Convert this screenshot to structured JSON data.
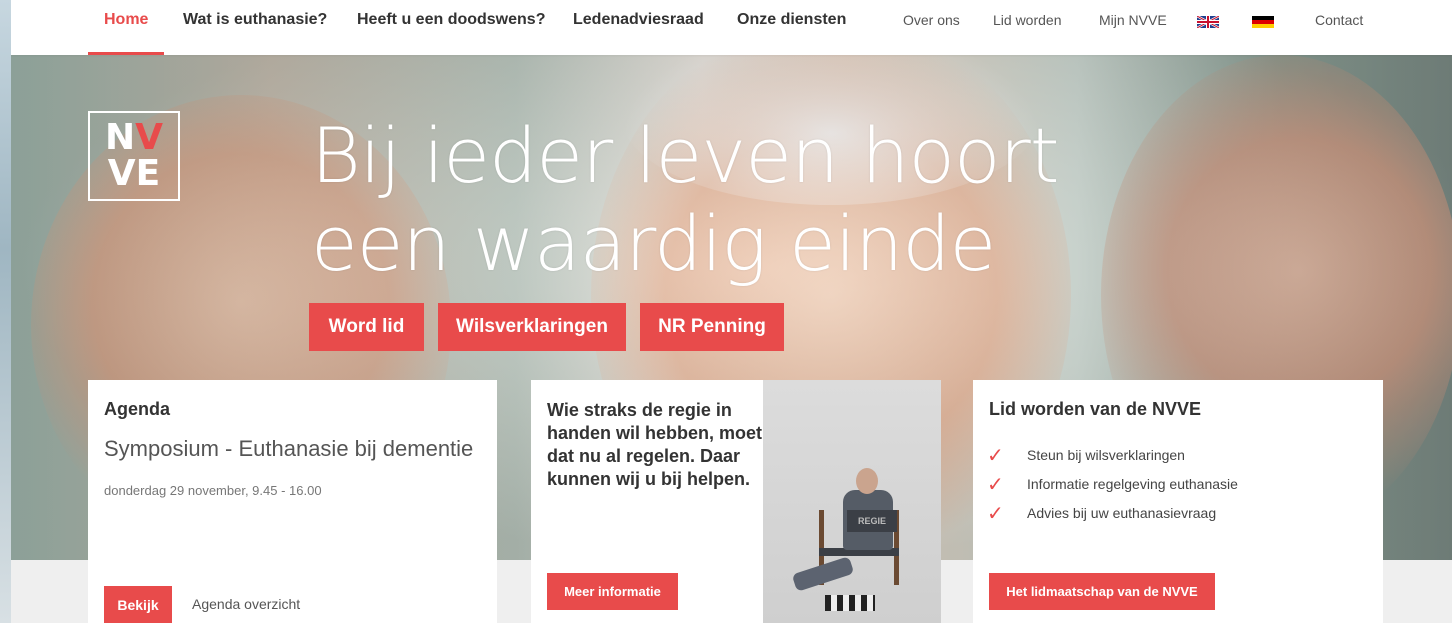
{
  "nav": {
    "primary": [
      "Home",
      "Wat is euthanasie?",
      "Heeft u een doodswens?",
      "Ledenadviesraad",
      "Onze diensten"
    ],
    "secondary": [
      "Over ons",
      "Lid worden",
      "Mijn NVVE",
      "Contact"
    ]
  },
  "hero": {
    "logo_top": "NV",
    "logo_bottom": "VE",
    "title_line1": "Bij ieder leven hoort",
    "title_line2": "een waardig einde",
    "buttons": [
      "Word lid",
      "Wilsverklaringen",
      "NR Penning"
    ]
  },
  "agenda": {
    "heading": "Agenda",
    "event_title": "Symposium - Euthanasie bij dementie",
    "event_date": "donderdag 29 november, 9.45 - 16.00",
    "button": "Bekijk",
    "link": "Agenda overzicht"
  },
  "promo": {
    "text": "Wie straks de regie in handen wil hebben, moet dat nu al regelen. Daar kunnen wij u bij helpen.",
    "button": "Meer informatie",
    "chair_text": "REGIE"
  },
  "membership": {
    "heading": "Lid worden van de NVVE",
    "benefits": [
      "Steun bij wilsverklaringen",
      "Informatie regelgeving euthanasie",
      "Advies bij uw euthanasievraag"
    ],
    "button": "Het lidmaatschap van de NVVE"
  },
  "colors": {
    "accent": "#e84b4b"
  },
  "icons": [
    "flag-uk-icon",
    "flag-de-icon",
    "check-icon"
  ]
}
